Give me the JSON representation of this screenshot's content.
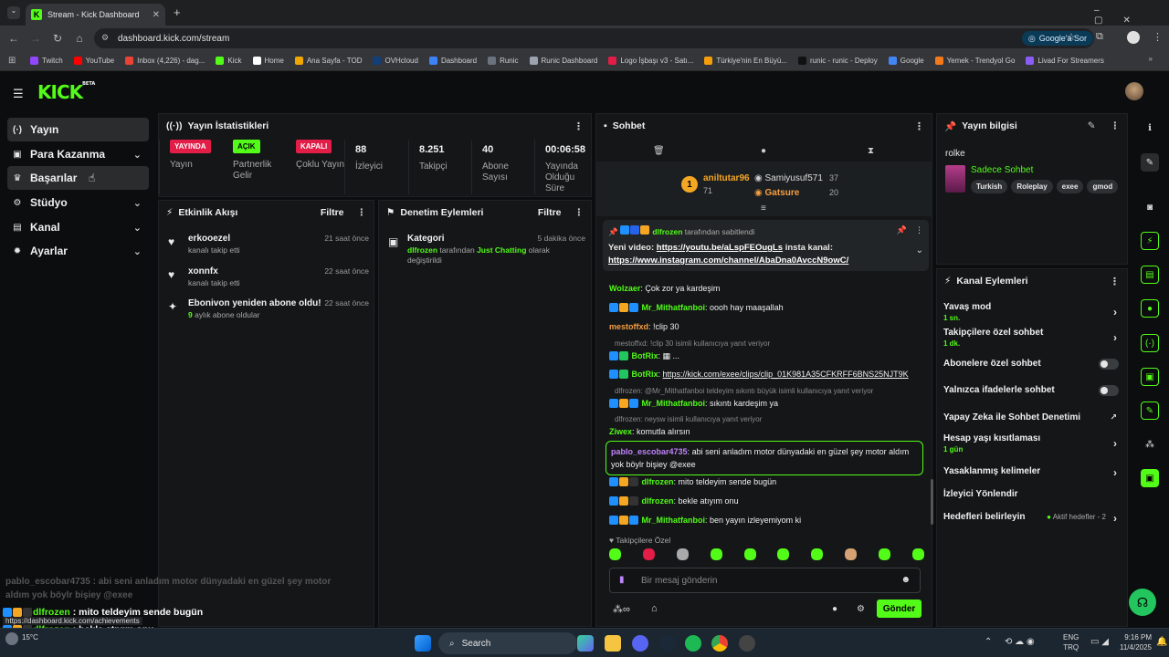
{
  "browser": {
    "tab_title": "Stream - Kick Dashboard",
    "url": "dashboard.kick.com/stream",
    "google_btn": "Google'a Sor",
    "bookmarks": [
      "Twitch",
      "YouTube",
      "Inbox (4,226) - dag...",
      "Kick",
      "Home",
      "Ana Sayfa - TOD",
      "OVHcloud",
      "Dashboard",
      "Runic",
      "Runic Dashboard",
      "Logo İşbaşı v3 - Satı...",
      "Türkiye'nin En Büyü...",
      "runic - runic - Deploy",
      "Google",
      "Yemek - Trendyol Go",
      "Livad For Streamers"
    ],
    "bookmark_colors": [
      "#9146ff",
      "#ff0000",
      "#ea4335",
      "#53fc18",
      "#ffffff",
      "#f0a800",
      "#123f79",
      "#3b82f6",
      "#6b7280",
      "#9ca3af",
      "#e11d48",
      "#f59e0b",
      "#111111",
      "#4285f4",
      "#f27a1a",
      "#8b5cf6"
    ]
  },
  "logo": "KICK",
  "logo_sup": "BETA",
  "sidebar": {
    "items": [
      {
        "label": "Yayın",
        "icon": "(·)"
      },
      {
        "label": "Para Kazanma",
        "icon": "▣"
      },
      {
        "label": "Başarılar",
        "icon": "♛"
      },
      {
        "label": "Stüdyo",
        "icon": "⚙"
      },
      {
        "label": "Kanal",
        "icon": "▤"
      },
      {
        "label": "Ayarlar",
        "icon": "✹"
      }
    ]
  },
  "stats": {
    "title": "Yayın İstatistikleri",
    "items": [
      {
        "badge": "YAYINDA",
        "label": "Yayın"
      },
      {
        "badge": "AÇIK",
        "label": "Partnerlik Gelir"
      },
      {
        "badge": "KAPALI",
        "label": "Çoklu Yayın"
      },
      {
        "value": "88",
        "label": "İzleyici"
      },
      {
        "value": "8.251",
        "label": "Takipçi"
      },
      {
        "value": "40",
        "label": "Abone Sayısı"
      },
      {
        "value": "00:06:58",
        "label": "Yayında Olduğu Süre"
      }
    ]
  },
  "activity": {
    "title": "Etkinlik Akışı",
    "filter": "Filtre",
    "items": [
      {
        "name": "erkooezel",
        "sub": "kanalı takip etti",
        "time": "21 saat önce",
        "icon": "♥"
      },
      {
        "name": "xonnfx",
        "sub": "kanalı takip etti",
        "time": "22 saat önce",
        "icon": "♥"
      },
      {
        "name": "Ebonivon yeniden abone oldu!",
        "sub_num": "9",
        "sub": " aylık abone oldular",
        "time": "22 saat önce",
        "icon": "✦"
      }
    ]
  },
  "moderation": {
    "title": "Denetim Eylemleri",
    "filter": "Filtre",
    "item": {
      "title": "Kategori",
      "time": "5 dakika önce",
      "user": "dlfrozen",
      "mid": " tarafından ",
      "cat": "Just Chatting",
      "end": " olarak değiştirildi"
    }
  },
  "chat": {
    "title": "Sohbet",
    "leaders": [
      {
        "rank": "1",
        "name": "aniltutar96",
        "count": "71"
      },
      {
        "name": "Samiyusuf571",
        "count": "37"
      },
      {
        "name": "Gatsure",
        "count": "20"
      }
    ],
    "pinned": {
      "by": "dlfrozen",
      "by_suffix": " tarafından sabitlendi",
      "text": "Yeni video: ",
      "link1": "https://youtu.be/aLspFEOugLs",
      "mid": " insta kanal: ",
      "link2": "https://www.instagram.com/channel/AbaDna0AvccN9owC/"
    },
    "messages": [
      {
        "user": "Wolzaer",
        "color": "#53fc18",
        "text": "Çok zor ya kardeşim"
      },
      {
        "user": "Mr_Mithatfanboi",
        "color": "#53fc18",
        "text": "oooh hay maaşallah"
      },
      {
        "user": "mestoffxd",
        "color": "#f59e42",
        "text": "!clip 30"
      },
      {
        "reply": "mestoffxd: !clip 30 isimli kullanıcıya yanıt veriyor",
        "user": "BotRix",
        "color": "#53fc18",
        "text": "▦ ..."
      },
      {
        "user": "BotRix",
        "color": "#53fc18",
        "text": "https://kick.com/exee/clips/clip_01K981A35CFKRFF6BNS25NJT9K"
      },
      {
        "reply": "dlfrozen: @Mr_Mithatfanboi teldeyim sıkıntı büyük isimli kullanıcıya yanıt veriyor",
        "user": "Mr_Mithatfanboi",
        "color": "#53fc18",
        "text": "sıkıntı kardeşim ya"
      },
      {
        "reply": "dlfrozen: neysw isimli kullanıcıya yanıt veriyor",
        "user": "Ziwex",
        "color": "#53fc18",
        "text": "komutla alırsın"
      },
      {
        "user": "pablo_escobar4735",
        "color": "#c084fc",
        "text": "abi seni anladım motor dünyadaki en güzel şey motor aldım yok böylr bişiey @exee"
      },
      {
        "user": "dlfrozen",
        "color": "#53fc18",
        "text": "mito teldeyim sende bugün"
      },
      {
        "user": "dlfrozen",
        "color": "#53fc18",
        "text": "bekle atıyım onu"
      },
      {
        "user": "Mr_Mithatfanboi",
        "color": "#53fc18",
        "text": "ben yayın izleyemiyom ki"
      }
    ],
    "followers_only": "Takipçilere Özel",
    "placeholder": "Bir mesaj gönderin",
    "send": "Gönder"
  },
  "info": {
    "title": "Yayın bilgisi",
    "stream_title": "rolke",
    "category": "Sadece Sohbet",
    "tags": [
      "Turkish",
      "Roleplay",
      "exee",
      "gmod"
    ]
  },
  "channel": {
    "title": "Kanal Eylemleri",
    "rows": [
      {
        "label": "Yavaş mod",
        "sub": "1 sn.",
        "ctl": "chev"
      },
      {
        "label": "Takipçilere özel sohbet",
        "sub": "1 dk.",
        "ctl": "chev"
      },
      {
        "label": "Abonelere özel sohbet",
        "ctl": "toggle"
      },
      {
        "label": "Yalnızca ifadelerle sohbet",
        "ctl": "toggle"
      },
      {
        "label": "Yapay Zeka ile Sohbet Denetimi",
        "ctl": "ext"
      },
      {
        "label": "Hesap yaşı kısıtlaması",
        "sub": "1 gün",
        "ctl": "chev"
      },
      {
        "label": "Yasaklanmış kelimeler",
        "ctl": "chev"
      },
      {
        "label": "İzleyici Yönlendir",
        "ctl": "none"
      },
      {
        "label": "Hedefleri belirleyin",
        "extra": "Aktif hedefler - 2",
        "ctl": "chev"
      }
    ]
  },
  "overlay": {
    "faded": "pablo_escobar4735 : abi seni anladım motor dünyadaki en güzel şey motor aldım yok böylr bişiey @exee",
    "lines": [
      {
        "user": "dlfrozen",
        "text": " : mito teldeyim sende bugün"
      },
      {
        "user": "dlfrozen",
        "text": " : bekle atıyım onu"
      },
      {
        "user": "Mr_Mithatfanboi",
        "text": " : ben yayın izleyemiyom ki"
      }
    ],
    "status_url": "https://dashboard.kick.com/achievements",
    "weather": "15°C"
  },
  "taskbar": {
    "search": "Search",
    "lang1": "ENG",
    "lang2": "TRQ",
    "time": "9:16 PM",
    "date": "11/4/2025"
  }
}
